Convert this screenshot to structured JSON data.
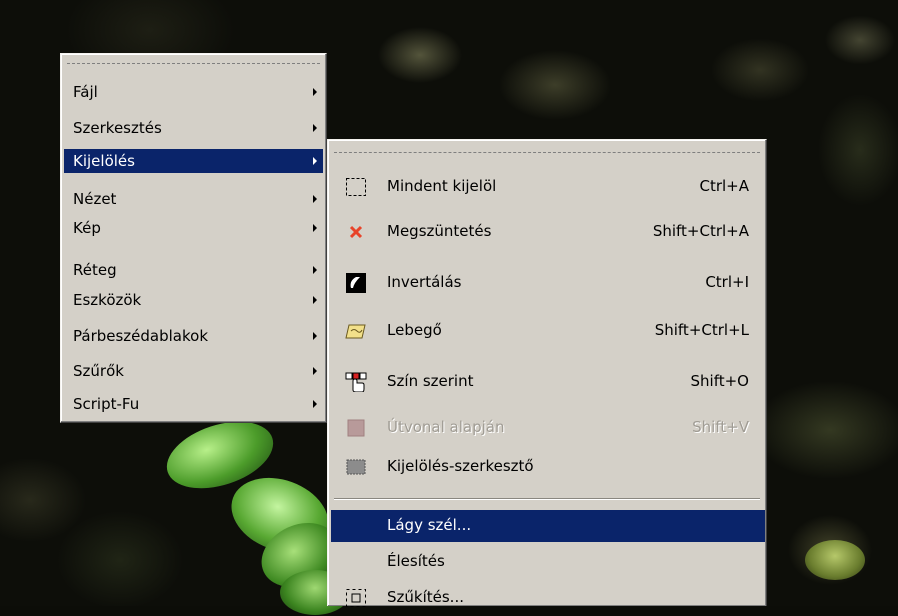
{
  "main_menu": {
    "items": [
      {
        "label": "Fájl"
      },
      {
        "label": "Szerkesztés"
      },
      {
        "label": "Kijelölés"
      },
      {
        "label": "Nézet"
      },
      {
        "label": "Kép"
      },
      {
        "label": "Réteg"
      },
      {
        "label": "Eszközök"
      },
      {
        "label": "Párbeszédablakok"
      },
      {
        "label": "Szűrők"
      },
      {
        "label": "Script-Fu"
      }
    ],
    "selected_index": 2
  },
  "submenu": {
    "items": [
      {
        "label": "Mindent kijelöl",
        "shortcut": "Ctrl+A",
        "icon": "select-all-icon"
      },
      {
        "label": "Megszüntetés",
        "shortcut": "Shift+Ctrl+A",
        "icon": "select-none-icon"
      },
      {
        "label": "Invertálás",
        "shortcut": "Ctrl+I",
        "icon": "invert-selection-icon"
      },
      {
        "label": "Lebegő",
        "shortcut": "Shift+Ctrl+L",
        "icon": "float-selection-icon"
      },
      {
        "label": "Szín szerint",
        "shortcut": "Shift+O",
        "icon": "select-by-color-icon"
      },
      {
        "label": "Útvonal alapján",
        "shortcut": "Shift+V",
        "icon": "path-to-selection-icon",
        "disabled": true
      },
      {
        "label": "Kijelölés-szerkesztő",
        "shortcut": "",
        "icon": "selection-editor-icon"
      },
      {
        "label": "Lágy szél...",
        "shortcut": "",
        "icon": ""
      },
      {
        "label": "Élesítés",
        "shortcut": "",
        "icon": ""
      },
      {
        "label": "Szűkítés...",
        "shortcut": "",
        "icon": "shrink-selection-icon"
      }
    ],
    "selected_index": 7
  },
  "colors": {
    "menu_background": "#d4d0c8",
    "selection_highlight": "#0a246a",
    "selection_text": "#ffffff",
    "disabled_text": "#a09c94"
  }
}
